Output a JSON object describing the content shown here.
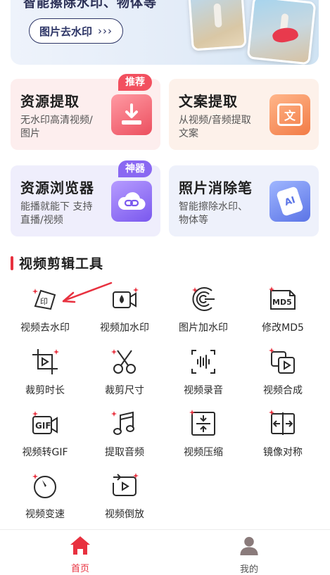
{
  "banner": {
    "title": "智能擦除水印、物体等",
    "button_label": "图片去水印",
    "button_chevrons": "›››"
  },
  "cards": [
    {
      "title": "资源提取",
      "desc": "无水印高清视频/图片",
      "badge": "推荐",
      "icon": "download-icon"
    },
    {
      "title": "文案提取",
      "desc": "从视频/音频提取文案",
      "badge": "",
      "icon": "document-text-icon",
      "icon_text": "文"
    },
    {
      "title": "资源浏览器",
      "desc": "能播就能下 支持直播/视频",
      "badge": "神器",
      "icon": "cloud-link-icon"
    },
    {
      "title": "照片消除笔",
      "desc": "智能擦除水印、物体等",
      "badge": "",
      "icon": "ai-eraser-icon",
      "icon_text": "AI"
    }
  ],
  "section_title": "视频剪辑工具",
  "tools": [
    {
      "label": "视频去水印",
      "icon": "video-watermark-remove-icon"
    },
    {
      "label": "视频加水印",
      "icon": "video-watermark-add-icon"
    },
    {
      "label": "图片加水印",
      "icon": "image-watermark-add-icon"
    },
    {
      "label": "修改MD5",
      "icon": "md5-icon",
      "icon_text": "MD5"
    },
    {
      "label": "裁剪时长",
      "icon": "crop-duration-icon"
    },
    {
      "label": "裁剪尺寸",
      "icon": "scissors-icon"
    },
    {
      "label": "视频录音",
      "icon": "audio-record-icon"
    },
    {
      "label": "视频合成",
      "icon": "video-merge-icon"
    },
    {
      "label": "视频转GIF",
      "icon": "gif-icon",
      "icon_text": "GIF"
    },
    {
      "label": "提取音频",
      "icon": "music-note-icon"
    },
    {
      "label": "视频压缩",
      "icon": "compress-icon"
    },
    {
      "label": "镜像对称",
      "icon": "mirror-icon"
    },
    {
      "label": "视频变速",
      "icon": "speed-dial-icon"
    },
    {
      "label": "视频倒放",
      "icon": "reverse-play-icon"
    }
  ],
  "bottom_nav": {
    "home_label": "首页",
    "mine_label": "我的",
    "active_color": "#e8313f"
  },
  "colors": {
    "accent": "#e8313f",
    "icon_stroke": "#2a2a2a",
    "sparkle": "#e8313f"
  }
}
